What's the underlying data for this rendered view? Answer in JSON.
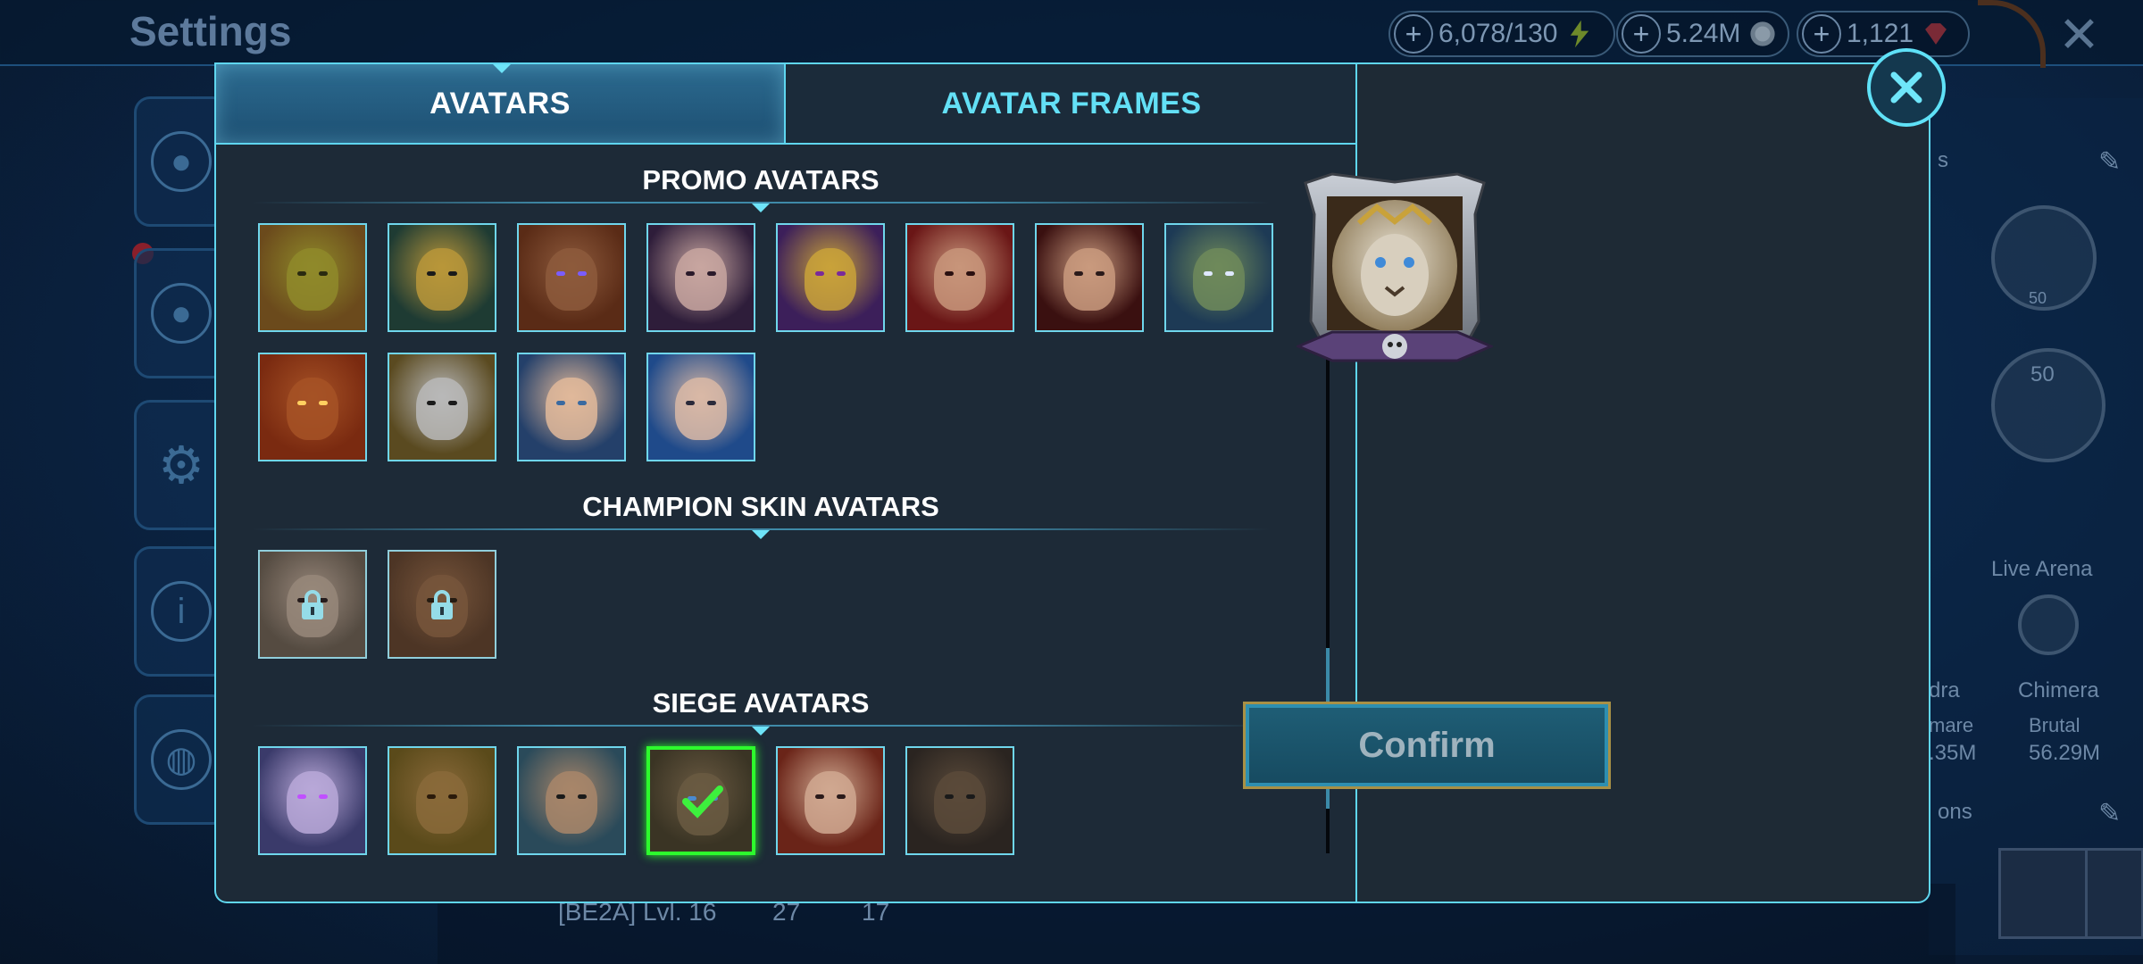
{
  "background": {
    "title": "Settings",
    "resources": [
      {
        "value": "6,078/130",
        "icon": "energy-bolt-icon"
      },
      {
        "value": "5.24M",
        "icon": "silver-coin-icon"
      },
      {
        "value": "1,121",
        "icon": "gem-icon"
      }
    ],
    "right_labels": {
      "live_arena": "Live Arena",
      "hydra": "dra",
      "chimera": "Chimera",
      "hydra_diff": "mare",
      "chimera_diff": "Brutal",
      "hydra_dmg": ".35M",
      "chimera_dmg": "56.29M",
      "emblem_level_1": "50",
      "emblem_level_2": "50",
      "section_top": "s",
      "section_bottom": "ons"
    },
    "player_bar": {
      "clan": "[BE2A] Lvl. 16",
      "stat1": "27",
      "stat2": "17"
    }
  },
  "modal": {
    "tabs": [
      {
        "label": "AVATARS",
        "active": true
      },
      {
        "label": "AVATAR FRAMES",
        "active": false
      }
    ],
    "sections": [
      {
        "title": "PROMO AVATARS",
        "avatars": [
          {
            "name": "toad-avatar",
            "locked": false,
            "selected": false,
            "bg": "#6b4a1c",
            "face": "#8f8a2a",
            "eyes": "#2a2a10"
          },
          {
            "name": "gold-helm-elf-avatar",
            "locked": false,
            "selected": false,
            "bg": "#1e3b33",
            "face": "#b9963a",
            "eyes": "#1a1a1a"
          },
          {
            "name": "warrior-purple-visor-avatar",
            "locked": false,
            "selected": false,
            "bg": "#5a2b16",
            "face": "#8d5a3c",
            "eyes": "#7a5cff"
          },
          {
            "name": "dark-haired-woman-avatar",
            "locked": false,
            "selected": false,
            "bg": "#2e1d3a",
            "face": "#c8a6a0",
            "eyes": "#2a1a2a"
          },
          {
            "name": "skeletor-avatar",
            "locked": false,
            "selected": false,
            "bg": "#3c1f5a",
            "face": "#c9a23a",
            "eyes": "#7a2a9a"
          },
          {
            "name": "red-knight-avatar",
            "locked": false,
            "selected": false,
            "bg": "#6a1616",
            "face": "#c8957a",
            "eyes": "#2a1010"
          },
          {
            "name": "sorceress-avatar",
            "locked": false,
            "selected": false,
            "bg": "#3a1010",
            "face": "#c99a7e",
            "eyes": "#2a1a1a"
          },
          {
            "name": "ent-druid-avatar",
            "locked": false,
            "selected": false,
            "bg": "#1d3a55",
            "face": "#6f8a5a",
            "eyes": "#dfe8ff"
          },
          {
            "name": "fire-demon-avatar",
            "locked": false,
            "selected": false,
            "bg": "#7a2a10",
            "face": "#a65226",
            "eyes": "#ffd060"
          },
          {
            "name": "crusader-helm-avatar",
            "locked": false,
            "selected": false,
            "bg": "#5a4a20",
            "face": "#b8b8b8",
            "eyes": "#1a1a1a"
          },
          {
            "name": "elf-princess-avatar",
            "locked": false,
            "selected": false,
            "bg": "#24406a",
            "face": "#e0b89a",
            "eyes": "#3a6aa0"
          },
          {
            "name": "scarred-woman-avatar",
            "locked": false,
            "selected": false,
            "bg": "#1f4a8a",
            "face": "#d9b8a6",
            "eyes": "#2a2a3a"
          }
        ]
      },
      {
        "title": "CHAMPION SKIN AVATARS",
        "avatars": [
          {
            "name": "locked-woman-avatar",
            "locked": true,
            "selected": false,
            "bg": "#5a4a3a",
            "face": "#a08670",
            "eyes": "#2a1a1a"
          },
          {
            "name": "locked-monkey-avatar",
            "locked": true,
            "selected": false,
            "bg": "#5a3218",
            "face": "#8a5226",
            "eyes": "#2a1a0a"
          }
        ]
      },
      {
        "title": "SIEGE AVATARS",
        "avatars": [
          {
            "name": "white-haired-sorceress-avatar",
            "locked": false,
            "selected": false,
            "bg": "#3a3a6a",
            "face": "#b8a8d8",
            "eyes": "#c050ff"
          },
          {
            "name": "ape-king-avatar",
            "locked": false,
            "selected": false,
            "bg": "#5a4a1a",
            "face": "#8a6a3a",
            "eyes": "#2a1a0a"
          },
          {
            "name": "tattooed-warrior-avatar",
            "locked": false,
            "selected": false,
            "bg": "#2a4a5a",
            "face": "#a8866a",
            "eyes": "#1a1a1a"
          },
          {
            "name": "white-lion-avatar",
            "locked": false,
            "selected": true,
            "bg": "#3a3424",
            "face": "#6a5a42",
            "eyes": "#4a8ad0"
          },
          {
            "name": "red-queen-avatar",
            "locked": false,
            "selected": false,
            "bg": "#6a2418",
            "face": "#d0a890",
            "eyes": "#2a1a1a"
          },
          {
            "name": "roaring-beast-avatar",
            "locked": false,
            "selected": false,
            "bg": "#2a2420",
            "face": "#5a4a3a",
            "eyes": "#1a1a1a"
          }
        ]
      }
    ],
    "confirm_label": "Confirm",
    "preview_name": "white-lion-avatar-preview"
  }
}
